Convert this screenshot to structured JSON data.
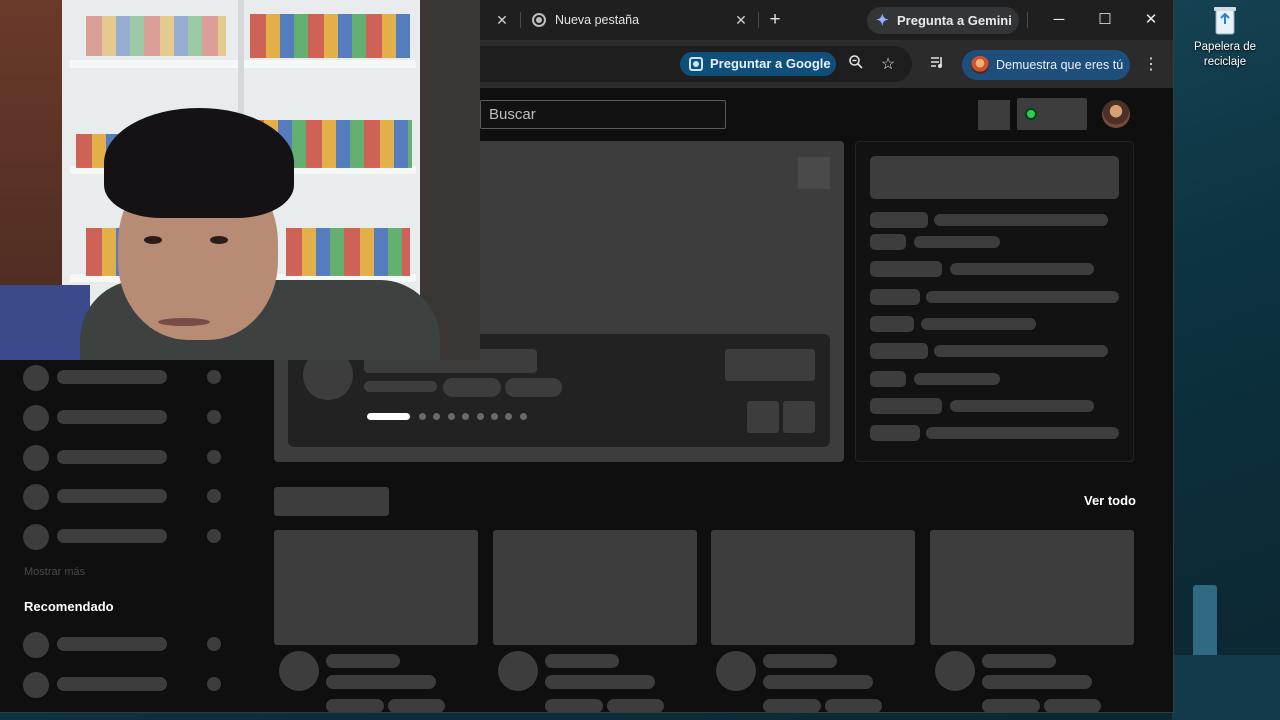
{
  "desktop": {
    "recycle_bin_label": "Papelera de reciclaje"
  },
  "browser": {
    "tab_title": "Nueva pestaña",
    "new_tab_symbol": "+",
    "gemini_label": "Pregunta a Gemini",
    "window_controls": {
      "minimize": "─",
      "maximize": "☐",
      "close": "✕"
    },
    "lens_label": "Preguntar a Google",
    "profile_chip_label": "Demuestra que eres tú",
    "close_symbol": "✕"
  },
  "page": {
    "search_placeholder": "Buscar",
    "ver_todo": "Ver todo",
    "mostrar_mas": "Mostrar más",
    "recomendado": "Recomendado",
    "carousel": {
      "slides": 9,
      "active": 0
    }
  },
  "icons": [
    "recycle-bin-icon",
    "chrome-icon",
    "gemini-spark-icon",
    "google-lens-icon",
    "zoom-icon",
    "star-icon",
    "media-icon",
    "menu-icon"
  ],
  "colors": {
    "lens_chip": "#0f4f7a",
    "profile_chip": "#1e4f7c",
    "skeleton": "#3d3d3d",
    "page_bg": "#0f0f0f"
  }
}
